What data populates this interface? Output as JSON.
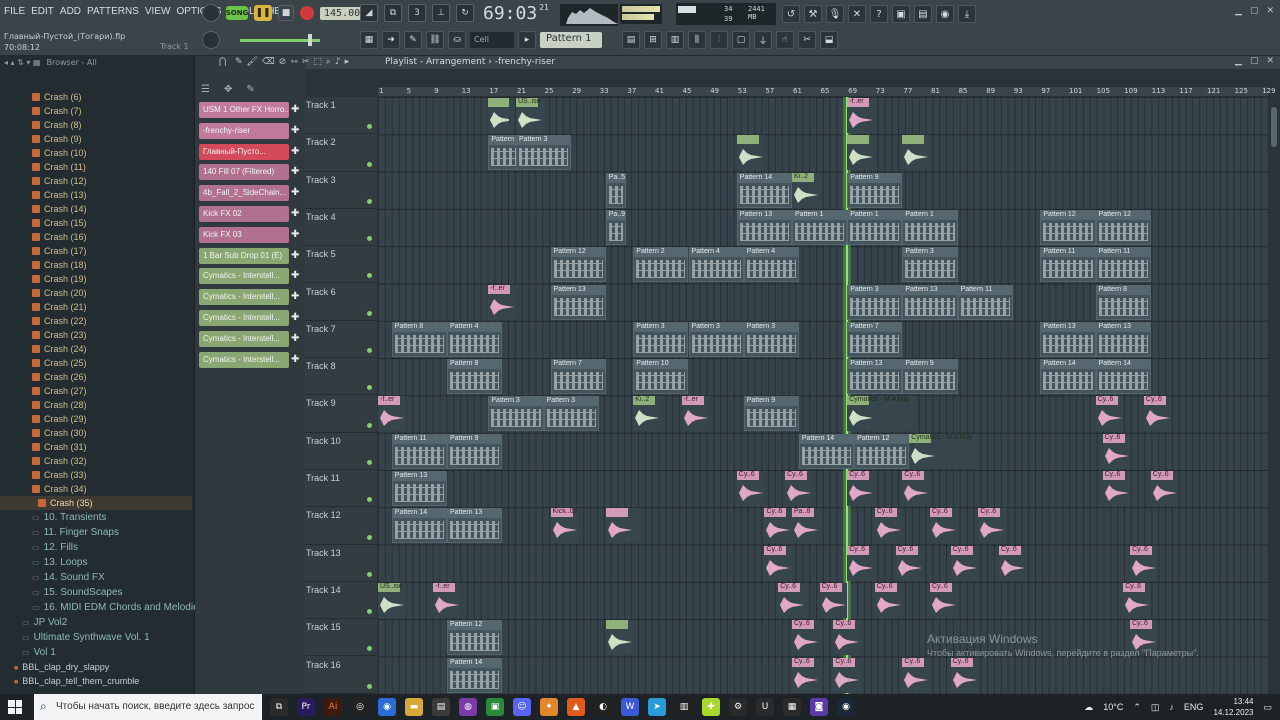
{
  "menu": [
    "FILE",
    "EDIT",
    "ADD",
    "PATTERNS",
    "VIEW",
    "OPTIONS",
    "TOOLS",
    "HELP"
  ],
  "file": {
    "name": "Главный-Пустой_(Тогари).flp",
    "time": "70:08:12",
    "hint": "Track 1"
  },
  "transport": {
    "song_label": "SONG",
    "tempo": "145.000",
    "time": "69:03",
    "time_frac": "21",
    "time_sub": "B:S:T"
  },
  "cpu": {
    "v1": "34",
    "v2": "39",
    "v3": "2441 MB",
    "v4": ""
  },
  "toolbar2": {
    "cell": "Cell",
    "pattern": "Pattern 1"
  },
  "browser": {
    "header": "Browser - All",
    "crash_items": [
      "Crash (6)",
      "Crash (7)",
      "Crash (8)",
      "Crash (9)",
      "Crash (10)",
      "Crash (11)",
      "Crash (12)",
      "Crash (13)",
      "Crash (14)",
      "Crash (15)",
      "Crash (16)",
      "Crash (17)",
      "Crash (18)",
      "Crash (19)",
      "Crash (20)",
      "Crash (21)",
      "Crash (22)",
      "Crash (23)",
      "Crash (24)",
      "Crash (25)",
      "Crash (26)",
      "Crash (27)",
      "Crash (28)",
      "Crash (29)",
      "Crash (30)",
      "Crash (31)",
      "Crash (32)",
      "Crash (33)",
      "Crash (34)"
    ],
    "selected": "Crash (35)",
    "folders": [
      "10. Transients",
      "11. Finger Snaps",
      "12. Fills",
      "13. Loops",
      "14. Sound FX",
      "15. SoundScapes",
      "16. MIDI EDM Chords and Melodies"
    ],
    "root_folders": [
      "JP Vol2",
      "Ultimate Synthwave Vol. 1",
      "Vol 1"
    ],
    "files": [
      "BBL_clap_dry_slappy",
      "BBL_clap_tell_them_crumble"
    ]
  },
  "channels": [
    {
      "name": "USM 1 Other FX Horro...",
      "color": "#c07a9c"
    },
    {
      "name": "-frenchy-riser",
      "color": "#c07a9c"
    },
    {
      "name": "Главный-Пусто...",
      "color": "#d44a5a"
    },
    {
      "name": "140 Fill 07 (Filtered)",
      "color": "#b0708e"
    },
    {
      "name": "4b_Fall_2_SideChain...",
      "color": "#b0708e"
    },
    {
      "name": "Kick FX 02",
      "color": "#b0708e"
    },
    {
      "name": "Kick FX 03",
      "color": "#b0708e"
    },
    {
      "name": "1 Bar Sub Drop 01 (E)",
      "color": "#8aa672"
    },
    {
      "name": "Cymatics - Interstell...",
      "color": "#8aa672"
    },
    {
      "name": "Cymatics - Interstell...",
      "color": "#8aa672"
    },
    {
      "name": "Cymatics - Interstell...",
      "color": "#8aa672"
    },
    {
      "name": "Cymatics - Interstell...",
      "color": "#8aa672"
    },
    {
      "name": "Cymatics - Interstell...",
      "color": "#8aa672"
    }
  ],
  "playlist": {
    "title": "Playlist - Arrangement",
    "subtitle": "-frenchy-riser",
    "ruler": [
      "1",
      "5",
      "9",
      "13",
      "17",
      "21",
      "25",
      "29",
      "33",
      "37",
      "41",
      "45",
      "49",
      "53",
      "57",
      "61",
      "65",
      "69",
      "73",
      "77",
      "81",
      "85",
      "89",
      "93",
      "97",
      "101",
      "105",
      "109",
      "113",
      "117",
      "121",
      "125",
      "129"
    ],
    "tracks": [
      "Track 1",
      "Track 2",
      "Track 3",
      "Track 4",
      "Track 5",
      "Track 6",
      "Track 7",
      "Track 8",
      "Track 9",
      "Track 10",
      "Track 11",
      "Track 12",
      "Track 13",
      "Track 14",
      "Track 15",
      "Track 16"
    ],
    "clips": [
      {
        "t": 0,
        "b": 17,
        "w": 3,
        "type": "audio",
        "label": ""
      },
      {
        "t": 0,
        "b": 21,
        "w": 4,
        "type": "audio",
        "label": "US..ise"
      },
      {
        "t": 0,
        "b": 69,
        "w": 4,
        "type": "pink",
        "label": "-f..er"
      },
      {
        "t": 1,
        "b": 17,
        "w": 8,
        "type": "pattern",
        "label": "Pattern 3"
      },
      {
        "t": 1,
        "b": 21,
        "w": 8,
        "type": "pattern",
        "label": "Pattern 3"
      },
      {
        "t": 1,
        "b": 53,
        "w": 4,
        "type": "audio",
        "label": ""
      },
      {
        "t": 1,
        "b": 69,
        "w": 4,
        "type": "audio",
        "label": ""
      },
      {
        "t": 1,
        "b": 77,
        "w": 4,
        "type": "audio",
        "label": ""
      },
      {
        "t": 2,
        "b": 34,
        "w": 3,
        "type": "pattern",
        "label": "Pa..5"
      },
      {
        "t": 2,
        "b": 53,
        "w": 8,
        "type": "pattern",
        "label": "Pattern 14"
      },
      {
        "t": 2,
        "b": 61,
        "w": 4,
        "type": "audio",
        "label": "Ki..2"
      },
      {
        "t": 2,
        "b": 69,
        "w": 8,
        "type": "pattern",
        "label": "Pattern 9"
      },
      {
        "t": 3,
        "b": 34,
        "w": 3,
        "type": "pattern",
        "label": "Pa..9"
      },
      {
        "t": 3,
        "b": 53,
        "w": 8,
        "type": "pattern",
        "label": "Pattern 13"
      },
      {
        "t": 3,
        "b": 61,
        "w": 8,
        "type": "pattern",
        "label": "Pattern 1"
      },
      {
        "t": 3,
        "b": 69,
        "w": 8,
        "type": "pattern",
        "label": "Pattern 1"
      },
      {
        "t": 3,
        "b": 77,
        "w": 8,
        "type": "pattern",
        "label": "Pattern 1"
      },
      {
        "t": 3,
        "b": 97,
        "w": 8,
        "type": "pattern",
        "label": "Pattern 12"
      },
      {
        "t": 3,
        "b": 105,
        "w": 8,
        "type": "pattern",
        "label": "Pattern 12"
      },
      {
        "t": 4,
        "b": 26,
        "w": 8,
        "type": "pattern",
        "label": "Pattern 12"
      },
      {
        "t": 4,
        "b": 38,
        "w": 8,
        "type": "pattern",
        "label": "Pattern 2"
      },
      {
        "t": 4,
        "b": 46,
        "w": 8,
        "type": "pattern",
        "label": "Pattern 4"
      },
      {
        "t": 4,
        "b": 54,
        "w": 8,
        "type": "pattern",
        "label": "Pattern 4"
      },
      {
        "t": 4,
        "b": 77,
        "w": 8,
        "type": "pattern",
        "label": "Pattern 3"
      },
      {
        "t": 4,
        "b": 97,
        "w": 8,
        "type": "pattern",
        "label": "Pattern 11"
      },
      {
        "t": 4,
        "b": 105,
        "w": 8,
        "type": "pattern",
        "label": "Pattern 11"
      },
      {
        "t": 5,
        "b": 17,
        "w": 4,
        "type": "pink",
        "label": "-f..er"
      },
      {
        "t": 5,
        "b": 26,
        "w": 8,
        "type": "pattern",
        "label": "Pattern 13"
      },
      {
        "t": 5,
        "b": 69,
        "w": 8,
        "type": "pattern",
        "label": "Pattern 3"
      },
      {
        "t": 5,
        "b": 77,
        "w": 8,
        "type": "pattern",
        "label": "Pattern 13"
      },
      {
        "t": 5,
        "b": 85,
        "w": 8,
        "type": "pattern",
        "label": "Pattern 11"
      },
      {
        "t": 5,
        "b": 105,
        "w": 8,
        "type": "pattern",
        "label": "Pattern 8"
      },
      {
        "t": 6,
        "b": 3,
        "w": 8,
        "type": "pattern",
        "label": "Pattern 8"
      },
      {
        "t": 6,
        "b": 11,
        "w": 8,
        "type": "pattern",
        "label": "Pattern 4"
      },
      {
        "t": 6,
        "b": 38,
        "w": 8,
        "type": "pattern",
        "label": "Pattern 3"
      },
      {
        "t": 6,
        "b": 46,
        "w": 8,
        "type": "pattern",
        "label": "Pattern 3"
      },
      {
        "t": 6,
        "b": 54,
        "w": 8,
        "type": "pattern",
        "label": "Pattern 3"
      },
      {
        "t": 6,
        "b": 69,
        "w": 8,
        "type": "pattern",
        "label": "Pattern 7"
      },
      {
        "t": 6,
        "b": 97,
        "w": 8,
        "type": "pattern",
        "label": "Pattern 13"
      },
      {
        "t": 6,
        "b": 105,
        "w": 8,
        "type": "pattern",
        "label": "Pattern 13"
      },
      {
        "t": 7,
        "b": 11,
        "w": 8,
        "type": "pattern",
        "label": "Pattern 8"
      },
      {
        "t": 7,
        "b": 26,
        "w": 8,
        "type": "pattern",
        "label": "Pattern 7"
      },
      {
        "t": 7,
        "b": 38,
        "w": 8,
        "type": "pattern",
        "label": "Pattern 10"
      },
      {
        "t": 7,
        "b": 69,
        "w": 8,
        "type": "pattern",
        "label": "Pattern 13"
      },
      {
        "t": 7,
        "b": 77,
        "w": 8,
        "type": "pattern",
        "label": "Pattern 9"
      },
      {
        "t": 7,
        "b": 97,
        "w": 8,
        "type": "pattern",
        "label": "Pattern 14"
      },
      {
        "t": 7,
        "b": 105,
        "w": 8,
        "type": "pattern",
        "label": "Pattern 14"
      },
      {
        "t": 8,
        "b": 1,
        "w": 4,
        "type": "pink",
        "label": "-f..er"
      },
      {
        "t": 8,
        "b": 17,
        "w": 8,
        "type": "pattern",
        "label": "Pattern 3"
      },
      {
        "t": 8,
        "b": 25,
        "w": 8,
        "type": "pattern",
        "label": "Pattern 3"
      },
      {
        "t": 8,
        "b": 38,
        "w": 4,
        "type": "audio",
        "label": "Ki..2"
      },
      {
        "t": 8,
        "b": 45,
        "w": 4,
        "type": "pink",
        "label": "-f..er"
      },
      {
        "t": 8,
        "b": 54,
        "w": 8,
        "type": "pattern",
        "label": "Pattern 9"
      },
      {
        "t": 8,
        "b": 69,
        "w": 10,
        "type": "audio",
        "label": "Cymatics - M A Maj"
      },
      {
        "t": 8,
        "b": 105,
        "w": 4,
        "type": "pink",
        "label": "Cy..6"
      },
      {
        "t": 8,
        "b": 112,
        "w": 4,
        "type": "pink",
        "label": "Cy..6"
      },
      {
        "t": 9,
        "b": 3,
        "w": 8,
        "type": "pattern",
        "label": "Pattern 11"
      },
      {
        "t": 9,
        "b": 11,
        "w": 8,
        "type": "pattern",
        "label": "Pattern 9"
      },
      {
        "t": 9,
        "b": 62,
        "w": 8,
        "type": "pattern",
        "label": "Pattern 14"
      },
      {
        "t": 9,
        "b": 70,
        "w": 8,
        "type": "pattern",
        "label": "Pattern 12"
      },
      {
        "t": 9,
        "b": 78,
        "w": 10,
        "type": "audio",
        "label": "Cymatics - M A Maj"
      },
      {
        "t": 9,
        "b": 106,
        "w": 4,
        "type": "pink",
        "label": "Cy..6"
      },
      {
        "t": 10,
        "b": 3,
        "w": 8,
        "type": "pattern",
        "label": "Pattern 13"
      },
      {
        "t": 10,
        "b": 53,
        "w": 4,
        "type": "pink",
        "label": "Cy..6"
      },
      {
        "t": 10,
        "b": 60,
        "w": 4,
        "type": "pink",
        "label": "Cy..6"
      },
      {
        "t": 10,
        "b": 69,
        "w": 4,
        "type": "pink",
        "label": "Cy..6"
      },
      {
        "t": 10,
        "b": 77,
        "w": 4,
        "type": "pink",
        "label": "Cy..6"
      },
      {
        "t": 10,
        "b": 106,
        "w": 4,
        "type": "pink",
        "label": "Cy..6"
      },
      {
        "t": 10,
        "b": 113,
        "w": 4,
        "type": "pink",
        "label": "Cy..6"
      },
      {
        "t": 11,
        "b": 3,
        "w": 8,
        "type": "pattern",
        "label": "Pattern 14"
      },
      {
        "t": 11,
        "b": 11,
        "w": 8,
        "type": "pattern",
        "label": "Pattern 13"
      },
      {
        "t": 11,
        "b": 26,
        "w": 4,
        "type": "pink",
        "label": "Kick..03"
      },
      {
        "t": 11,
        "b": 34,
        "w": 5,
        "type": "pink",
        "label": ""
      },
      {
        "t": 11,
        "b": 57,
        "w": 4,
        "type": "pink",
        "label": "Cy..6"
      },
      {
        "t": 11,
        "b": 61,
        "w": 4,
        "type": "pink",
        "label": "Pa..8"
      },
      {
        "t": 11,
        "b": 73,
        "w": 4,
        "type": "pink",
        "label": "Cy..6"
      },
      {
        "t": 11,
        "b": 81,
        "w": 4,
        "type": "pink",
        "label": "Cy..6"
      },
      {
        "t": 11,
        "b": 88,
        "w": 4,
        "type": "pink",
        "label": "Cy..6"
      },
      {
        "t": 12,
        "b": 57,
        "w": 4,
        "type": "pink",
        "label": "Cy..6"
      },
      {
        "t": 12,
        "b": 69,
        "w": 4,
        "type": "pink",
        "label": "Cy..6"
      },
      {
        "t": 12,
        "b": 76,
        "w": 4,
        "type": "pink",
        "label": "Cy..6"
      },
      {
        "t": 12,
        "b": 84,
        "w": 4,
        "type": "pink",
        "label": "Cy..6"
      },
      {
        "t": 12,
        "b": 91,
        "w": 4,
        "type": "pink",
        "label": "Cy..6"
      },
      {
        "t": 12,
        "b": 110,
        "w": 4,
        "type": "pink",
        "label": "Cy..6"
      },
      {
        "t": 13,
        "b": 1,
        "w": 4,
        "type": "audio",
        "label": "US..ise"
      },
      {
        "t": 13,
        "b": 9,
        "w": 4,
        "type": "pink",
        "label": "-f..er"
      },
      {
        "t": 13,
        "b": 59,
        "w": 4,
        "type": "pink",
        "label": "Cy..6"
      },
      {
        "t": 13,
        "b": 65,
        "w": 4,
        "type": "pink",
        "label": "Cy..6"
      },
      {
        "t": 13,
        "b": 73,
        "w": 4,
        "type": "pink",
        "label": "Cy..6"
      },
      {
        "t": 13,
        "b": 81,
        "w": 4,
        "type": "pink",
        "label": "Cy..6"
      },
      {
        "t": 13,
        "b": 109,
        "w": 4,
        "type": "pink",
        "label": "Cy..6"
      },
      {
        "t": 14,
        "b": 11,
        "w": 8,
        "type": "pattern",
        "label": "Pattern 12"
      },
      {
        "t": 14,
        "b": 34,
        "w": 4,
        "type": "audio",
        "label": ""
      },
      {
        "t": 14,
        "b": 61,
        "w": 4,
        "type": "pink",
        "label": "Cy..6"
      },
      {
        "t": 14,
        "b": 67,
        "w": 4,
        "type": "pink",
        "label": "Cy..6"
      },
      {
        "t": 14,
        "b": 110,
        "w": 4,
        "type": "pink",
        "label": "Cy..6"
      },
      {
        "t": 15,
        "b": 11,
        "w": 8,
        "type": "pattern",
        "label": "Pattern 14"
      },
      {
        "t": 15,
        "b": 61,
        "w": 4,
        "type": "pink",
        "label": "Cy..6"
      },
      {
        "t": 15,
        "b": 67,
        "w": 4,
        "type": "pink",
        "label": "Cy..6"
      },
      {
        "t": 15,
        "b": 77,
        "w": 4,
        "type": "pink",
        "label": "Cy..6"
      },
      {
        "t": 15,
        "b": 84,
        "w": 4,
        "type": "pink",
        "label": "Cy..6"
      }
    ]
  },
  "watermark": {
    "title": "Активация Windows",
    "body": "Чтобы активировать Windows, перейдите в раздел \"Параметры\"."
  },
  "taskbar": {
    "search_placeholder": "Чтобы начать поиск, введите здесь запрос",
    "weather": "10°C",
    "lang": "ENG",
    "time": "13:44",
    "date": "14.12.2023"
  }
}
